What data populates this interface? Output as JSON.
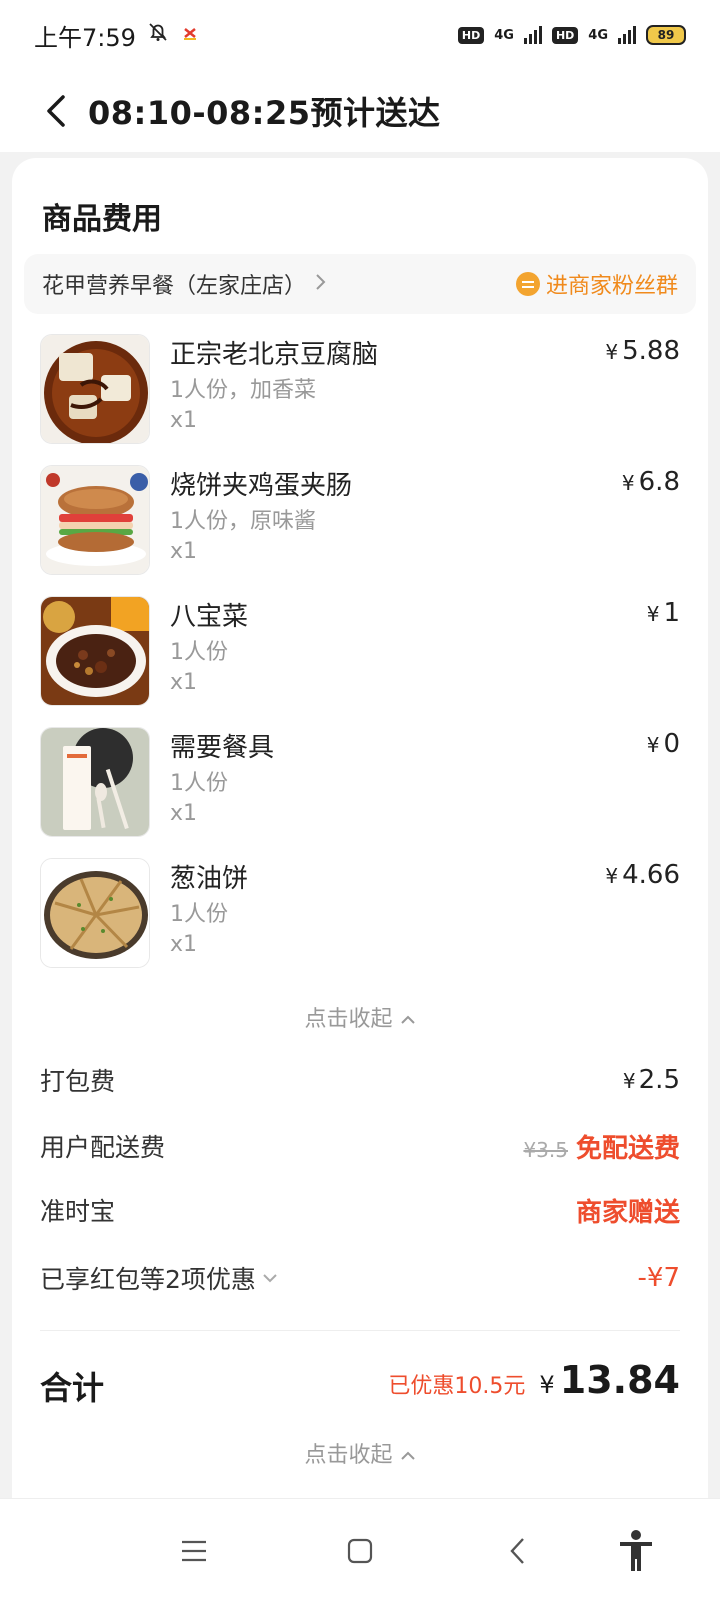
{
  "status_bar": {
    "time": "上午7:59",
    "net_labels": [
      "4G",
      "4G"
    ],
    "hd_label": "HD",
    "battery": "89"
  },
  "header": {
    "title": "08:10-08:25预计送达"
  },
  "card": {
    "section_title": "商品费用",
    "store": {
      "name": "花甲营养早餐（左家庄店）",
      "fans_label": "进商家粉丝群"
    },
    "items": [
      {
        "name": "正宗老北京豆腐脑",
        "spec": "1人份，加香菜",
        "qty": "x1",
        "price_symbol": "¥",
        "price": "5.88"
      },
      {
        "name": "烧饼夹鸡蛋夹肠",
        "spec": "1人份，原味酱",
        "qty": "x1",
        "price_symbol": "¥",
        "price": "6.8"
      },
      {
        "name": "八宝菜",
        "spec": "1人份",
        "qty": "x1",
        "price_symbol": "¥",
        "price": "1"
      },
      {
        "name": "需要餐具",
        "spec": "1人份",
        "qty": "x1",
        "price_symbol": "¥",
        "price": "0"
      },
      {
        "name": "葱油饼",
        "spec": "1人份",
        "qty": "x1",
        "price_symbol": "¥",
        "price": "4.66"
      }
    ],
    "collapse_label": "点击收起",
    "fees": {
      "packing_label": "打包费",
      "packing_symbol": "¥",
      "packing_value": "2.5",
      "delivery_label": "用户配送费",
      "delivery_original": "¥3.5",
      "delivery_value": "免配送费",
      "ontime_label": "准时宝",
      "ontime_value": "商家赠送",
      "discount_label": "已享红包等2项优惠",
      "discount_value": "-¥7"
    },
    "total": {
      "label": "合计",
      "saved": "已优惠10.5元",
      "symbol": "¥",
      "amount": "13.84"
    },
    "collapse_label_bottom": "点击收起"
  },
  "colors": {
    "accent_orange": "#f08a1c",
    "discount_red": "#ee4d2d"
  }
}
